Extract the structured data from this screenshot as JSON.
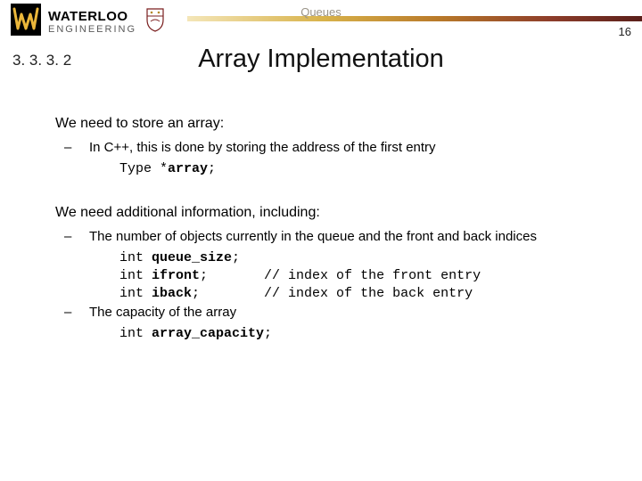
{
  "brand": {
    "name_line1": "WATERLOO",
    "name_line2": "ENGINEERING",
    "accent": "#d8b24a"
  },
  "header": {
    "topic": "Queues",
    "page_number": "16"
  },
  "section_number": "3. 3. 3. 2",
  "title": "Array Implementation",
  "content": {
    "p1": "We need to store an array:",
    "p1_sub1": "In C++, this is done by storing the address of the first entry",
    "p1_code_type": "Type *",
    "p1_code_var": "array",
    "p1_code_semi": ";",
    "p2": "We need additional information, including:",
    "p2_sub1": "The number of objects currently in the queue and the front and back indices",
    "c_int": "int ",
    "c_qs": "queue_size",
    "c_if": "ifront",
    "c_ib": "iback",
    "c_semi": ";",
    "c_pad_front": ";       ",
    "c_pad_back": ";        ",
    "c_front_cmt": "// index of the front entry",
    "c_back_cmt": "// index of the back entry",
    "p2_sub2": "The capacity of the array",
    "c_cap": "array_capacity"
  }
}
